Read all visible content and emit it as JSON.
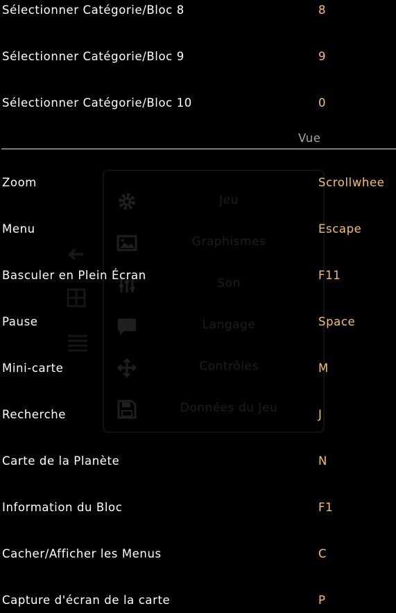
{
  "background_menu": {
    "items": [
      {
        "label": "Jeu",
        "icon": "gear-icon"
      },
      {
        "label": "Graphismes",
        "icon": "image-icon"
      },
      {
        "label": "Son",
        "icon": "sliders-icon"
      },
      {
        "label": "Langage",
        "icon": "speech-bubble-icon"
      },
      {
        "label": "Contrôles",
        "icon": "move-arrows-icon"
      },
      {
        "label": "Données du Jeu",
        "icon": "floppy-disk-icon"
      }
    ]
  },
  "top_bindings": [
    {
      "label": "Sélectionner Catégorie/Bloc 8",
      "key": "8"
    },
    {
      "label": "Sélectionner Catégorie/Bloc 9",
      "key": "9"
    },
    {
      "label": "Sélectionner Catégorie/Bloc 10",
      "key": "0"
    }
  ],
  "section": {
    "title": "Vue"
  },
  "view_bindings": [
    {
      "label": "Zoom",
      "key": "Scrollwhee"
    },
    {
      "label": "Menu",
      "key": "Escape"
    },
    {
      "label": "Basculer en Plein Écran",
      "key": "F11"
    },
    {
      "label": "Pause",
      "key": "Space"
    },
    {
      "label": "Mini-carte",
      "key": "M"
    },
    {
      "label": "Recherche",
      "key": "J"
    },
    {
      "label": "Carte de la Planète",
      "key": "N"
    },
    {
      "label": "Information du Bloc",
      "key": "F1"
    },
    {
      "label": "Cacher/Afficher les Menus",
      "key": "C"
    },
    {
      "label": "Capture d'écran de la carte",
      "key": "P"
    }
  ],
  "colors": {
    "background": "#000000",
    "label": "#ffffff",
    "key": "#f5c163",
    "section_title": "#a6a6a6",
    "divider": "#7b7b7b",
    "faded_menu": "#1d1d1d"
  }
}
